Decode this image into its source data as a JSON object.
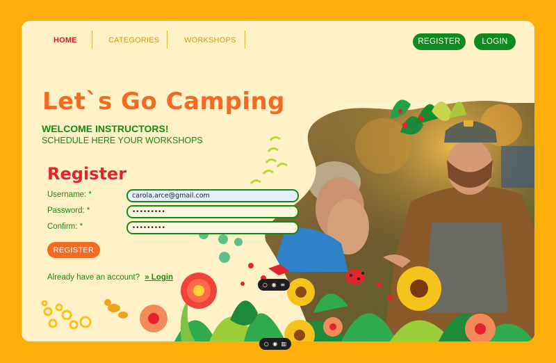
{
  "nav": {
    "home": "HOME",
    "categories": "CATEGORIES",
    "workshops": "WORKSHOPS",
    "register": "REGISTER",
    "login": "LOGIN"
  },
  "hero": {
    "title": "Let`s Go Camping",
    "welcome": "WELCOME INSTRUCTORS!",
    "subtitle": "SCHEDULE HERE YOUR WORKSHOPS"
  },
  "form": {
    "title": "Register",
    "username_label": "Username: *",
    "username_value": "carola.arce@gmail.com",
    "password_label": "Password: *",
    "password_value": "•••••••••",
    "confirm_label": "Confirm: *",
    "confirm_value": "•••••••••",
    "submit_label": "REGISTER",
    "already_text": "Already have an account?",
    "login_link": "» Login"
  },
  "toolbars": {
    "icons": [
      "comment-icon",
      "eye-icon",
      "menu-icon",
      "book-icon"
    ]
  },
  "colors": {
    "page_background": "#fcae0b",
    "card_background": "#fff2c8",
    "accent_green": "#138a11",
    "accent_orange": "#f26b22",
    "accent_red": "#e3242c"
  }
}
